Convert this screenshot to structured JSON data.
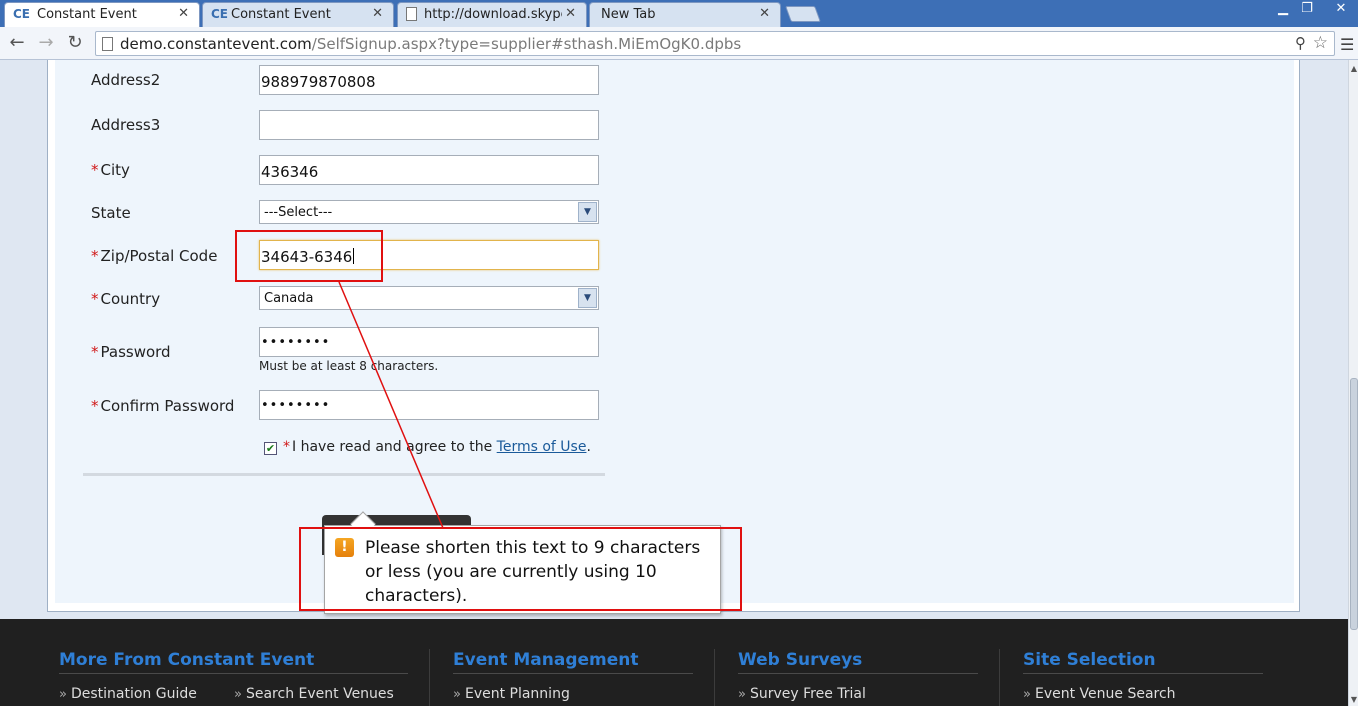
{
  "browser": {
    "tabs": [
      {
        "label": "Constant Event",
        "favicon": "CE",
        "active": true
      },
      {
        "label": "Constant Event",
        "favicon": "CE",
        "active": false
      },
      {
        "label": "http://download.skype.c",
        "favicon": "page",
        "active": false
      },
      {
        "label": "New Tab",
        "favicon": "",
        "active": false
      }
    ],
    "url_host": "demo.constantevent.com",
    "url_path": "/SelfSignup.aspx?type=supplier#sthash.MiEmOgK0.dpbs"
  },
  "form": {
    "address2": {
      "label": "Address2",
      "value": "988979870808"
    },
    "address3": {
      "label": "Address3",
      "value": ""
    },
    "city": {
      "label": "City",
      "value": "436346"
    },
    "state": {
      "label": "State",
      "selected": "---Select---"
    },
    "zip": {
      "label": "Zip/Postal Code",
      "value": "34643-6346"
    },
    "country": {
      "label": "Country",
      "selected": "Canada"
    },
    "password": {
      "label": "Password",
      "value": "••••••••",
      "hint": "Must be at least 8 characters."
    },
    "confirm_password": {
      "label": "Confirm Password",
      "value": "••••••••"
    },
    "required_marker": "*",
    "agree_text": "I have read and agree to the ",
    "terms_link": "Terms of Use",
    "agree_suffix": "."
  },
  "validation": {
    "icon": "!",
    "message": "Please shorten this text to 9 characters or less (you are currently using 10 characters)."
  },
  "footer": {
    "columns": [
      {
        "heading": "More From Constant Event",
        "links": [
          "Destination Guide",
          "Search Event Venues"
        ]
      },
      {
        "heading": "Event Management",
        "links": [
          "Event Planning"
        ]
      },
      {
        "heading": "Web Surveys",
        "links": [
          "Survey Free Trial"
        ]
      },
      {
        "heading": "Site Selection",
        "links": [
          "Event Venue Search"
        ]
      }
    ]
  },
  "colors": {
    "annotation": "#e01010",
    "link": "#2f7fd6",
    "required": "#d01818"
  }
}
